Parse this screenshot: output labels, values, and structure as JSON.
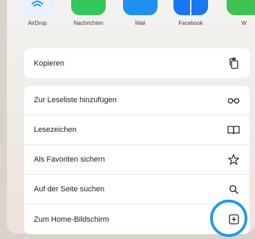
{
  "share_apps": [
    {
      "label": "AirDrop",
      "color": "#e8f0fb",
      "icon": "airdrop-icon"
    },
    {
      "label": "Nachrichten",
      "color": "#34c759",
      "icon": "messages-icon"
    },
    {
      "label": "Mail",
      "color": "#1e90f0",
      "icon": "mail-icon"
    },
    {
      "label": "Facebook",
      "color": "#1877f2",
      "icon": "facebook-icon"
    },
    {
      "label": "W",
      "color": "#3fc351",
      "icon": "app-icon"
    }
  ],
  "actions_group1": [
    {
      "label": "Kopieren",
      "icon": "copy-icon"
    }
  ],
  "actions_group2": [
    {
      "label": "Zur Leseliste hinzufügen",
      "icon": "glasses-icon"
    },
    {
      "label": "Lesezeichen",
      "icon": "book-icon"
    },
    {
      "label": "Als Favoriten sichern",
      "icon": "star-icon"
    },
    {
      "label": "Auf der Seite suchen",
      "icon": "search-icon"
    },
    {
      "label": "Zum Home-Bildschirm",
      "icon": "add-square-icon"
    }
  ],
  "highlight_color": "#1d9be0"
}
